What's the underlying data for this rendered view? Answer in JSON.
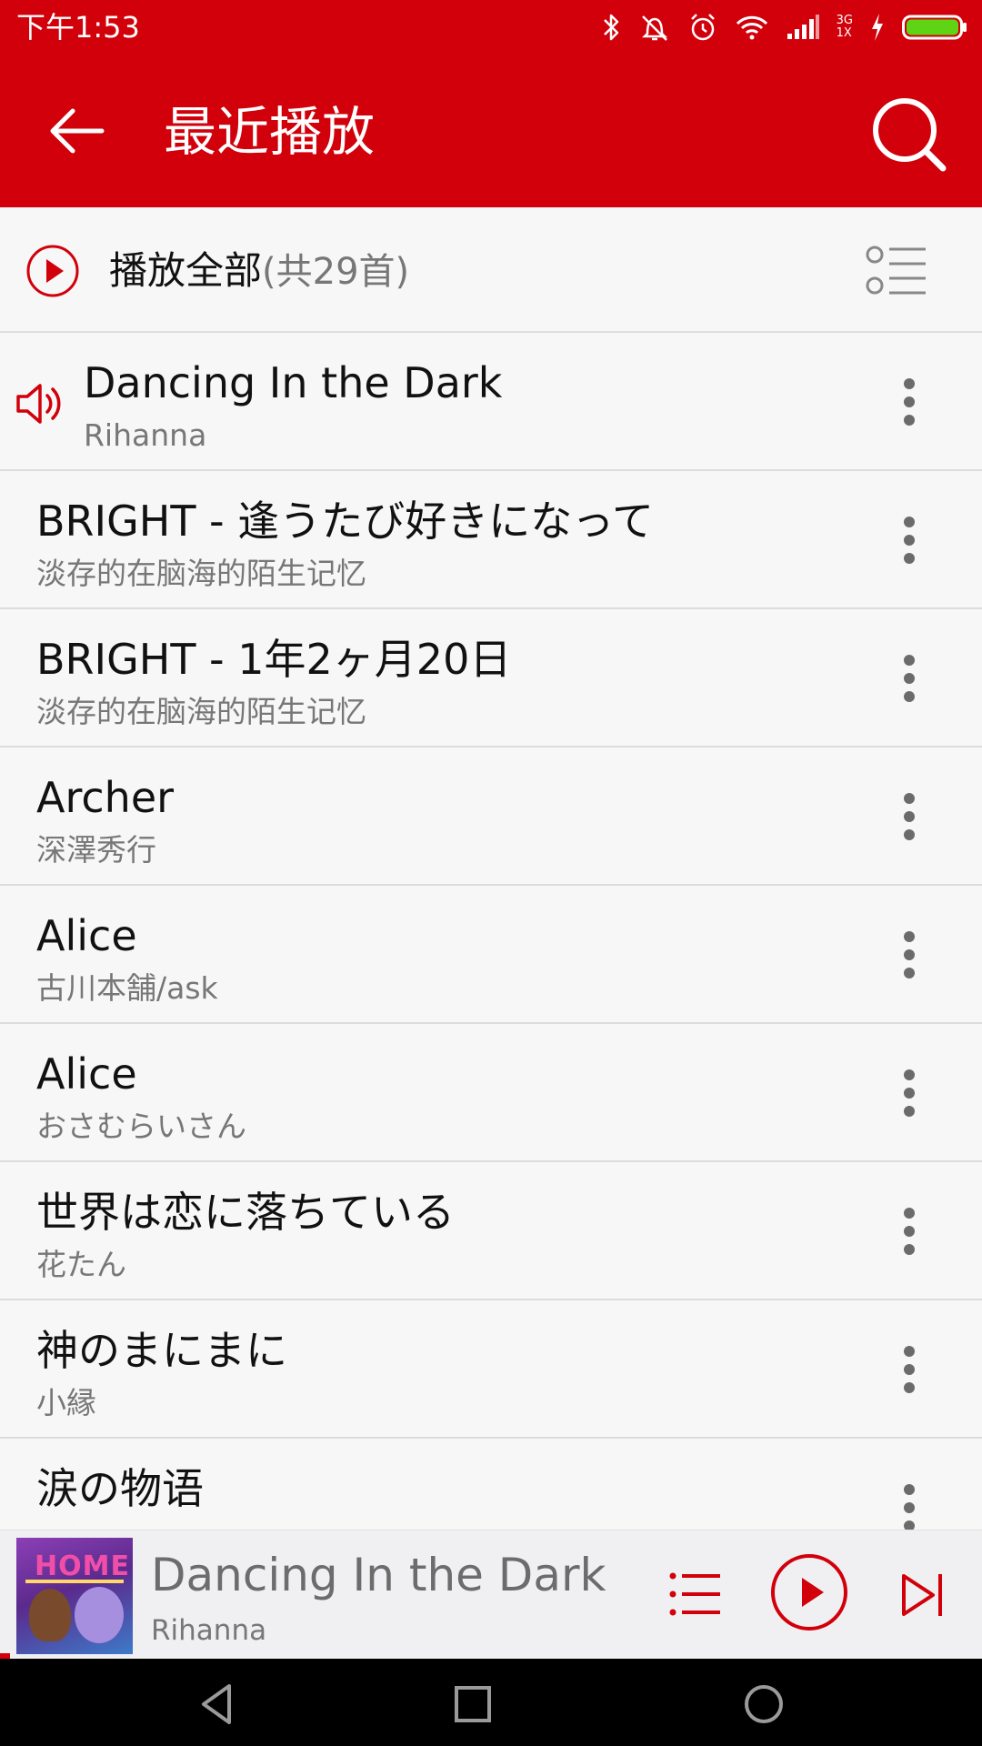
{
  "status_bar": {
    "time": "下午1:53",
    "network_label_top": "3G",
    "network_label_bottom": "1X",
    "icons": [
      "bluetooth-icon",
      "vibrate-off-icon",
      "alarm-icon",
      "wifi-icon",
      "signal-icon",
      "charging-icon",
      "battery-icon"
    ],
    "battery_color": "#5fd414"
  },
  "app_bar": {
    "title": "最近播放",
    "back_icon": "arrow-left-icon",
    "search_icon": "search-icon",
    "color": "#d1000a"
  },
  "play_all": {
    "label": "播放全部",
    "count": "(共29首)",
    "play_icon": "play-circle-icon",
    "multi_select_icon": "list-select-icon"
  },
  "songs": [
    {
      "title": "Dancing In the Dark",
      "artist": "Rihanna",
      "playing": true
    },
    {
      "title": "BRIGHT - 逢うたび好きになって",
      "artist": "淡存的在脑海的陌生记忆",
      "playing": false
    },
    {
      "title": "BRIGHT - 1年2ヶ月20日",
      "artist": "淡存的在脑海的陌生记忆",
      "playing": false
    },
    {
      "title": "Archer",
      "artist": "深澤秀行",
      "playing": false
    },
    {
      "title": "Alice",
      "artist": "古川本舗/ask",
      "playing": false
    },
    {
      "title": "Alice",
      "artist": "おさむらいさん",
      "playing": false
    },
    {
      "title": "世界は恋に落ちている",
      "artist": "花たん",
      "playing": false
    },
    {
      "title": "神のまにまに",
      "artist": "小縁",
      "playing": false
    },
    {
      "title": "涙の物语",
      "artist": "",
      "playing": false
    }
  ],
  "mini_player": {
    "title": "Dancing In the Dark",
    "artist": "Rihanna",
    "album_art_text": "HOME",
    "progress_fraction": 0.01,
    "queue_icon": "queue-list-icon",
    "play_icon": "play-icon",
    "next_icon": "skip-next-icon"
  },
  "nav_bar": {
    "icons": [
      "nav-back-icon",
      "nav-recents-icon",
      "nav-home-icon"
    ]
  }
}
